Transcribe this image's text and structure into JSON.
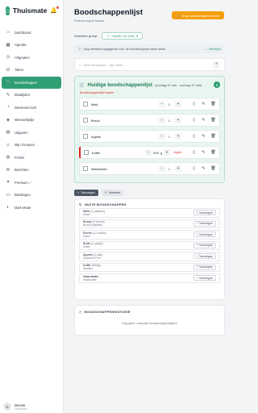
{
  "app": {
    "name": "Thuismate"
  },
  "sidebar": {
    "items": [
      {
        "icon": "⌂",
        "icon_name": "dashboard-icon",
        "label": "Dashboard"
      },
      {
        "icon": "▦",
        "icon_name": "calendar-icon",
        "label": "Agenda"
      },
      {
        "icon": "◷",
        "icon_name": "clock-icon",
        "label": "Afspraken"
      },
      {
        "icon": "☑",
        "icon_name": "checklist-icon",
        "label": "Taken"
      },
      {
        "icon": "🛒",
        "icon_name": "cart-icon",
        "label": "Boodschappen",
        "active": true
      },
      {
        "icon": "✎",
        "icon_name": "meal-icon",
        "label": "Maaltijden"
      },
      {
        "icon": "◔",
        "icon_name": "weekoverview-icon",
        "label": "Weekoverzicht"
      },
      {
        "icon": "◈",
        "icon_name": "tag-icon",
        "label": "Wensenlijstje"
      },
      {
        "icon": "▤",
        "icon_name": "expenses-icon",
        "label": "Uitgaven"
      },
      {
        "icon": "☺",
        "icon_name": "group-icon",
        "label": "Mijn Groepen"
      },
      {
        "icon": "◍",
        "icon_name": "profile-icon",
        "label": "Profiel"
      },
      {
        "icon": "✉",
        "icon_name": "messages-icon",
        "label": "Berichten"
      },
      {
        "icon": "✦",
        "icon_name": "premium-icon",
        "label": "Premium ✓"
      },
      {
        "icon": "▭",
        "icon_name": "payments-icon",
        "label": "Betalingen"
      },
      {
        "icon": "◐",
        "icon_name": "darkmode-icon",
        "label": "Dark Mode"
      }
    ],
    "user": {
      "initials": "D",
      "name": "Dennis",
      "role": "Gebruiker"
    }
  },
  "header": {
    "title": "Boodschappenlijst",
    "subtitle": "5 items nog te kopen",
    "cta_label": "Ik ga boodschappen doen"
  },
  "group": {
    "label": "Selecteer groep:",
    "selected": "Familie de Vries"
  },
  "info": {
    "text": "Nog niemand opgegeven voor de boodschappen deze week",
    "link": "Weeklijst"
  },
  "search": {
    "placeholder": "Snel toevoegen... bijv. Melk"
  },
  "current_list": {
    "title": "Huidige boodschappenlijst",
    "date_range": "(zondag 11 mei - zondag 17 mei)",
    "count": "5",
    "copy_label": "Boodschappenlijst kopen",
    "items": [
      {
        "name": "Melk",
        "qty": "1",
        "unit": "",
        "urgent": false,
        "tag": ""
      },
      {
        "name": "Brood",
        "qty": "1",
        "unit": "",
        "urgent": false,
        "tag": ""
      },
      {
        "name": "Appels",
        "qty": "1",
        "unit": "",
        "urgent": false,
        "tag": ""
      },
      {
        "name": "Koffie",
        "qty": "500",
        "unit": "g",
        "urgent": true,
        "tag": "Urgent"
      },
      {
        "name": "Wasmiddel",
        "qty": "1",
        "unit": "",
        "urgent": false,
        "tag": ""
      }
    ]
  },
  "tabs": [
    {
      "label": "Toevoegen",
      "active": true
    },
    {
      "label": "Verberen",
      "active": false
    }
  ],
  "fixed": {
    "title": "VASTE BOODSCHAPPEN",
    "add_label": "Toevoegen",
    "items": [
      {
        "name": "Melk",
        "qty": "(1 pakken)",
        "category": "Zuivel"
      },
      {
        "name": "Brood",
        "qty": "(1 brood)",
        "category": "Brood & Bakkerij"
      },
      {
        "name": "Eieren",
        "qty": "(12 stuks)",
        "category": "Zuivel"
      },
      {
        "name": "Boter",
        "qty": "(1 pakje)",
        "category": "Zuivel"
      },
      {
        "name": "Appels",
        "qty": "(1 zak)",
        "category": "Groente & Fruit"
      },
      {
        "name": "Koffie",
        "qty": "(500g)",
        "category": "Dranken"
      },
      {
        "name": "Wasmiddel",
        "qty": "",
        "category": "Huishouden"
      }
    ]
  },
  "history": {
    "title": "BOODSCHAPPENHISTORIE",
    "empty": "Nog geen voltooide boodschappenlijsten"
  },
  "colors": {
    "brand": "#2f9e74",
    "accent": "#f59e0b",
    "urgent": "#dc2626"
  }
}
